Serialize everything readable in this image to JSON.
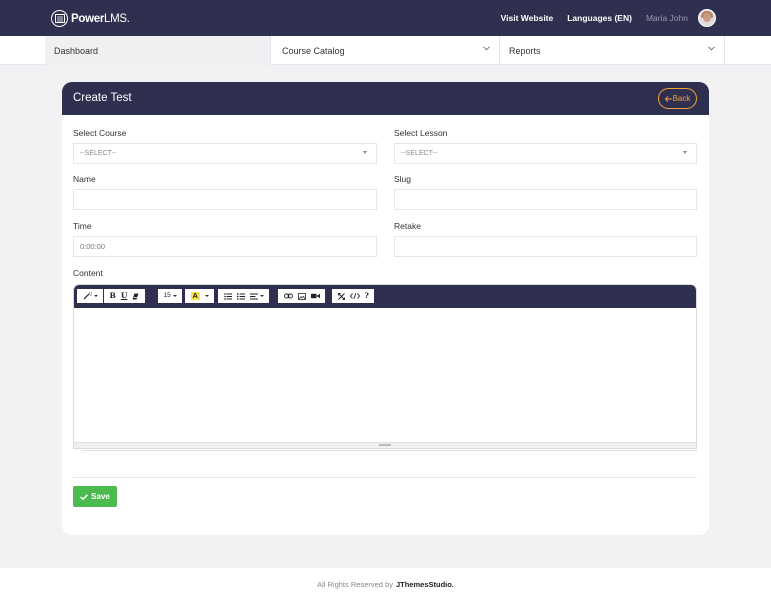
{
  "header": {
    "logo_bold": "Power",
    "logo_light": "LMS.",
    "visit_website": "Visit Website",
    "languages": "Languages (EN)",
    "user_name": "Maria John"
  },
  "nav": {
    "items": [
      {
        "label": "Dashboard"
      },
      {
        "label": "Course Catalog"
      },
      {
        "label": "Reports"
      }
    ]
  },
  "form": {
    "title": "Create Test",
    "back_label": "Back",
    "select_course_label": "Select Course",
    "select_course_value": "--SELECT--",
    "select_lesson_label": "Select Lesson",
    "select_lesson_value": "--SELECT--",
    "name_label": "Name",
    "name_value": "",
    "slug_label": "Slug",
    "slug_value": "",
    "time_label": "Time",
    "time_value": "0:00:00",
    "retake_label": "Retake",
    "retake_value": "",
    "content_label": "Content",
    "font_size": "15",
    "save_label": "Save"
  },
  "footer": {
    "text": "All Rights Reserved by",
    "brand": "JThemesStudio."
  },
  "colors": {
    "header_bg": "#2f2f4f",
    "accent_orange": "#f2a23c",
    "save_green": "#4cbb4f"
  }
}
